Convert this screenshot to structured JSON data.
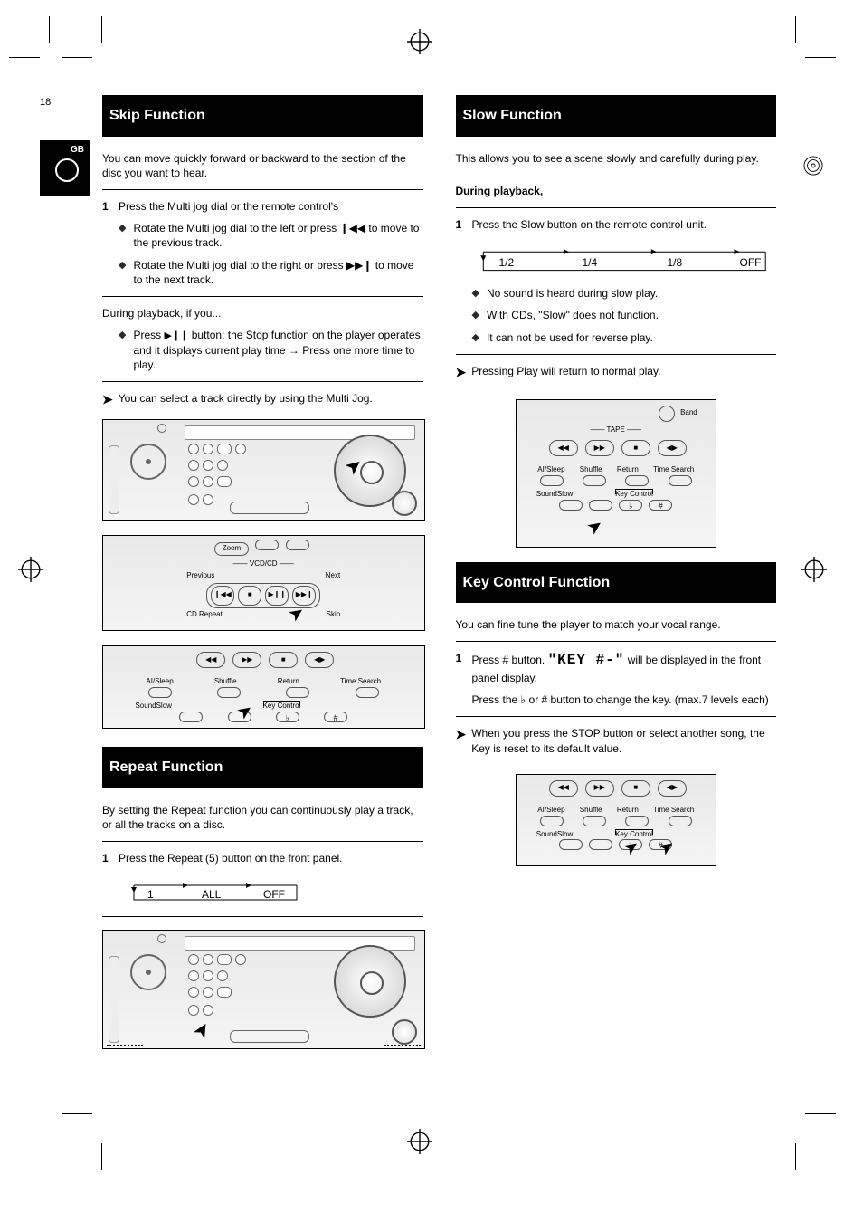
{
  "page_number": "18",
  "side_label": "GB",
  "sections": {
    "skip": {
      "title": "Skip Function",
      "intro": "You can move quickly forward or backward to the section of the disc you want to hear.",
      "step1_num": "1",
      "step1_text": "Press the Multi jog dial or the remote control's",
      "step1_prev": "Rotate the Multi jog dial to the left or press ❙◀◀ to move to the previous track.",
      "step1_next": "Rotate the Multi jog dial to the right or press ▶▶❙ to move to the next track.",
      "note_intro": "During playback, if you...",
      "note_item": "Press ▶❙❙ button: the Stop function on the player operates and it displays current play time → Press one more time to play.",
      "note_tail": "You can select a track directly by using the Multi Jog."
    },
    "slow": {
      "title": "Slow Function",
      "intro_sentence": "This allows you to see a scene slowly and carefully during play.",
      "intro_bold": "During playback,",
      "step1_num": "1",
      "step1_text": "Press the Slow button on the remote control unit.",
      "flow_items": [
        "1/2",
        "1/4",
        "1/8",
        "OFF"
      ],
      "note_item1": "No sound is heard during slow play.",
      "note_item2": "With CDs, \"Slow\" does not function.",
      "note_item3": "It can not be used for reverse play.",
      "note_tail": "Pressing Play will return to normal play."
    },
    "repeat": {
      "title": "Repeat Function",
      "intro": "By setting the Repeat function you can continuously play a track, or all the tracks on a disc.",
      "step1_num": "1",
      "step1_text": "Press the Repeat (5) button on the front panel.",
      "flow_items": [
        "1",
        "ALL",
        "OFF"
      ]
    },
    "keycontrol": {
      "title": "Key Control Function",
      "intro": "You can fine tune the player to match your vocal range.",
      "step1_num": "1",
      "step1_text_prefix": "Press # button.",
      "step1_text_suffix": " will be displayed in the front panel display.",
      "display_text": "\"KEY #-\"",
      "step1b": "Press the ♭ or # button to change the key. (max.7 levels each)",
      "note": "When you press the STOP button or select  another song, the Key is reset to its default value."
    }
  },
  "remote": {
    "zoom": "Zoom",
    "vcd_cd": "VCD/CD",
    "previous": "Previous",
    "next": "Next",
    "cd_repeat": "CD Repeat",
    "skip": "Skip",
    "play_pause": "▶❙❙",
    "stop": "■",
    "prev_track": "❙◀◀",
    "next_track": "▶▶❙",
    "rew": "◀◀",
    "ff": "▶▶",
    "ai_sleep": "AI/Sleep",
    "shuffle": "Shuffle",
    "return": "Return",
    "time_search": "Time Search",
    "sound": "Sound",
    "slow": "Slow",
    "key_control": "Key Control",
    "flat": "♭",
    "sharp": "#",
    "band": "Band",
    "tape": "TAPE",
    "tape_play_rev": "◀▶"
  }
}
